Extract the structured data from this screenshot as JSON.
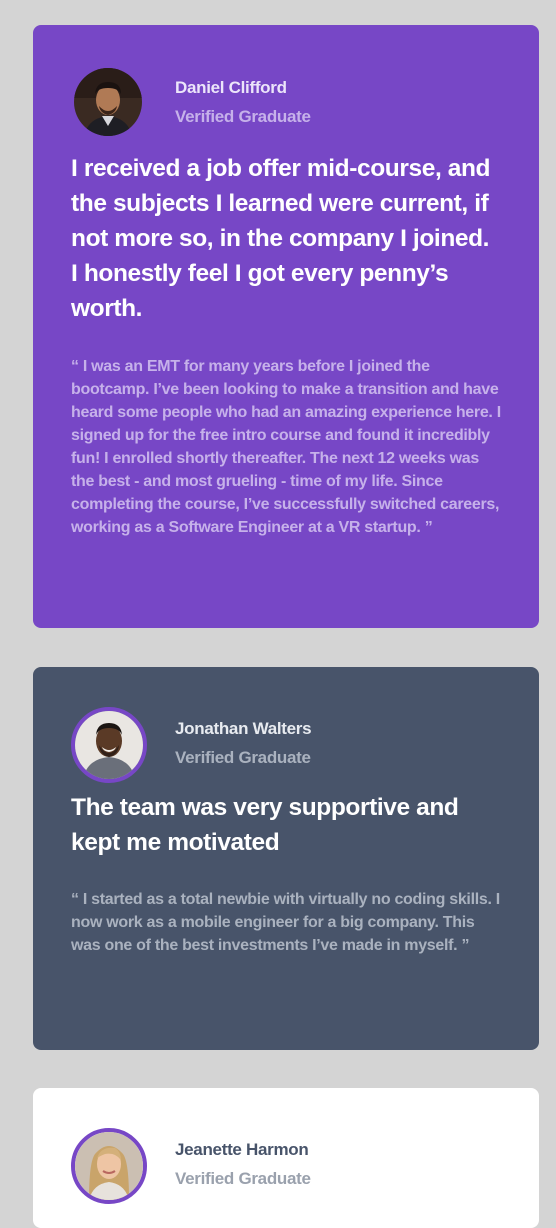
{
  "testimonials": [
    {
      "name": "Daniel Clifford",
      "role": "Verified Graduate",
      "headline": "I received a job offer mid-course, and the subjects I learned were current, if not more so, in the company I joined. I honestly feel I got every penny’s worth.",
      "quote": "“ I was an EMT for many years before I joined the bootcamp. I’ve been looking to make a transition and have heard some people who had an amazing experience here. I signed up for the free intro course and found it incredibly fun! I enrolled shortly thereafter. The next 12 weeks was the best - and most grueling - time of my life. Since completing the course, I’ve successfully switched careers, working as a Software Engineer at a VR startup. ”"
    },
    {
      "name": "Jonathan Walters",
      "role": "Verified Graduate",
      "headline": "The team was very supportive and kept me motivated",
      "quote": "“ I started as a total newbie with virtually no coding skills. I now work as a mobile engineer for a big company. This was one of the best investments I’ve made in myself. ”"
    },
    {
      "name": "Jeanette Harmon",
      "role": "Verified Graduate"
    }
  ]
}
